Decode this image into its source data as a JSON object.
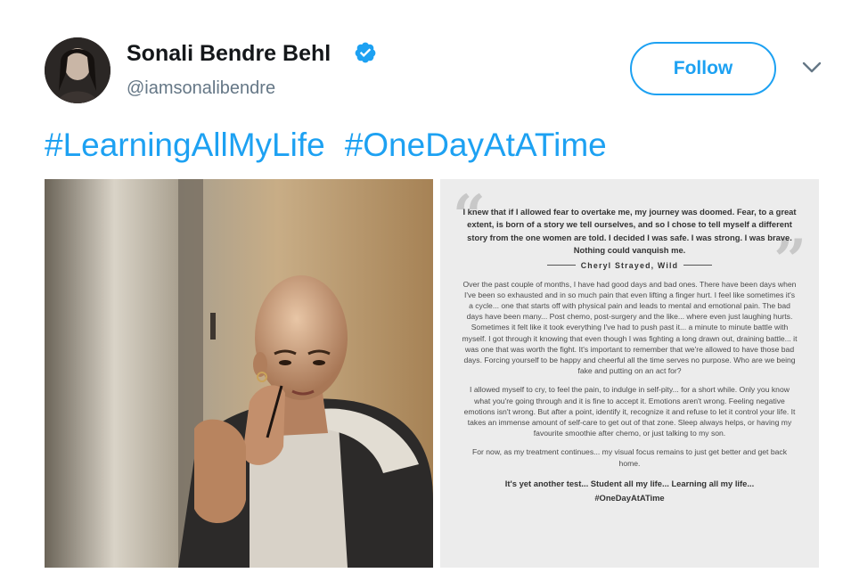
{
  "author": {
    "name": "Sonali Bendre Behl",
    "handle": "@iamsonalibendre",
    "verified": true,
    "avatar_icon": "avatar-photo"
  },
  "actions": {
    "follow_label": "Follow",
    "more_icon": "chevron-down-icon"
  },
  "tweet": {
    "hashtags": [
      "#LearningAllMyLife",
      "#OneDayAtATime"
    ]
  },
  "media": {
    "photo_left_icon": "portrait-photo",
    "note": {
      "quote": "I knew that if I allowed fear to overtake me, my journey was doomed. Fear, to a great extent, is born of a story we tell ourselves, and so I chose to tell myself a different story from the one women are told. I decided I was safe. I was strong. I was brave. Nothing could vanquish me.",
      "attribution": "Cheryl Strayed, Wild",
      "paragraphs": [
        "Over the past couple of months, I have had good days and bad ones. There have been days when I've been so exhausted and in so much pain that even lifting a finger hurt. I feel like sometimes it's a cycle... one that starts off with physical pain and leads to mental and emotional pain. The bad days have been many... Post chemo, post-surgery and the like... where even just laughing hurts. Sometimes it felt like it took everything I've had to push past it... a minute to minute battle with myself. I got through it knowing that even though I was fighting a long drawn out, draining battle... it was one that was worth the fight. It's important to remember that we're allowed to have those bad days. Forcing yourself to be happy and cheerful all the time serves no purpose. Who are we being fake and putting on an act for?",
        "I allowed myself to cry, to feel the pain, to indulge in self-pity... for a short while. Only you know what you're going through and it is fine to accept it. Emotions aren't wrong. Feeling negative emotions isn't wrong. But after a point, identify it, recognize it and refuse to let it control your life. It takes an immense amount of self-care to get out of that zone. Sleep always helps, or having my favourite smoothie after chemo, or just talking to my son.",
        "For now, as my treatment continues... my visual focus remains to just get better and get back home."
      ],
      "closing_line": "It's yet another test... Student all my life... Learning all my life...",
      "closing_tag": "#OneDayAtATime"
    }
  },
  "colors": {
    "accent": "#1da1f2",
    "text": "#14171a",
    "secondary": "#657786"
  }
}
